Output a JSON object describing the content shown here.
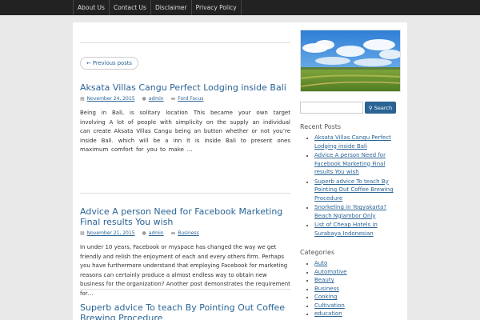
{
  "nav": {
    "items": [
      "About Us",
      "Contact Us",
      "Disclaimer",
      "Privacy Policy"
    ]
  },
  "pager": {
    "previous_label": "← Previous posts"
  },
  "posts": [
    {
      "title": "Aksata Villas Cangu Perfect Lodging inside Bali",
      "date": "November 24, 2015",
      "author": "admin",
      "category": "Ford Focus",
      "excerpt": "Being in Bali, is solitary location This became your own target involving A lot of people with simplicity on the supply an individual can create Aksata Villas Cangu being an button whether or not you’re inside Bali. which will be a inn It is inside Bali to present ones maximum comfort for you to make …"
    },
    {
      "title": "Advice A person Need for Facebook Marketing Final results You wish",
      "date": "November 21, 2015",
      "author": "admin",
      "category": "Business",
      "excerpt": "In under 10 years, Facebook or myspace has changed the way we get friendly and relish the enjoyment of each and every others firm. Perhaps you have furthermore understand that employing Facebook for marketing reasons can certainly produce a almost endless way to obtain new business for the organization? Another post demonstrates the requirement for…"
    },
    {
      "title": "Superb advice To teach By Pointing Out Coffee Brewing Procedure"
    }
  ],
  "sidebar": {
    "search_button": "Search",
    "search_icon": "magnifier-icon",
    "recent_title": "Recent Posts",
    "recent_posts": [
      "Aksata Villas Cangu Perfect Lodging inside Bali",
      "Advice A person Need for Facebook Marketing Final results You wish",
      "Superb advice To teach By Pointing Out Coffee Brewing Procedure",
      "Snorkeling in Yogyakarta? Beach Nglambor Only",
      "List of Cheap Hotels in Surabaya Indonesian"
    ],
    "categories_title": "Categories",
    "categories": [
      "Auto",
      "Automotive",
      "Beauty",
      "Business",
      "Cooking",
      "Cultivation",
      "education"
    ]
  },
  "colors": {
    "topbar": "#222222",
    "link": "#2a6496",
    "search_button": "#2a6496",
    "page_bg": "#e9e9e9"
  }
}
